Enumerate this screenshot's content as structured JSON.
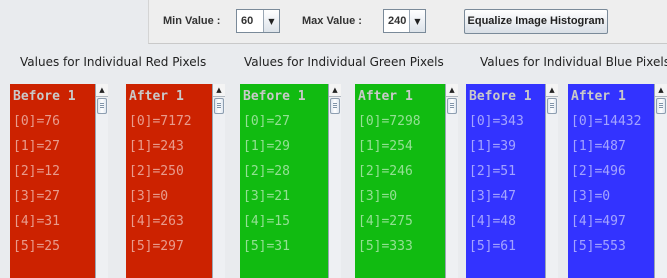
{
  "toolbar": {
    "min_label": "Min Value :",
    "min_value": "60",
    "max_label": "Max Value :",
    "max_value": "240",
    "equalize_label": "Equalize Image Histogram"
  },
  "sections": {
    "red_title": "Values for Individual Red Pixels",
    "green_title": "Values for Individual Green Pixels",
    "blue_title": "Values for Individual Blue Pixels"
  },
  "lists": {
    "red_before": [
      "Before 1",
      "[0]=76",
      "[1]=27",
      "[2]=12",
      "[3]=27",
      "[4]=31",
      "[5]=25"
    ],
    "red_after": [
      "After 1",
      "[0]=7172",
      "[1]=243",
      "[2]=250",
      "[3]=0",
      "[4]=263",
      "[5]=297"
    ],
    "green_before": [
      "Before 1",
      "[0]=27",
      "[1]=29",
      "[2]=28",
      "[3]=21",
      "[4]=15",
      "[5]=31"
    ],
    "green_after": [
      "After 1",
      "[0]=7298",
      "[1]=254",
      "[2]=246",
      "[3]=0",
      "[4]=275",
      "[5]=333"
    ],
    "blue_before": [
      "Before 1",
      "[0]=343",
      "[1]=39",
      "[2]=51",
      "[3]=47",
      "[4]=48",
      "[5]=61"
    ],
    "blue_after": [
      "After 1",
      "[0]=14432",
      "[1]=487",
      "[2]=496",
      "[3]=0",
      "[4]=497",
      "[5]=553"
    ]
  },
  "colors": {
    "red": "#cc2200",
    "green": "#11bb11",
    "blue": "#3333ff"
  },
  "icons": {
    "dropdown": "chevron-down-icon",
    "scroll_up": "arrow-up-icon"
  }
}
